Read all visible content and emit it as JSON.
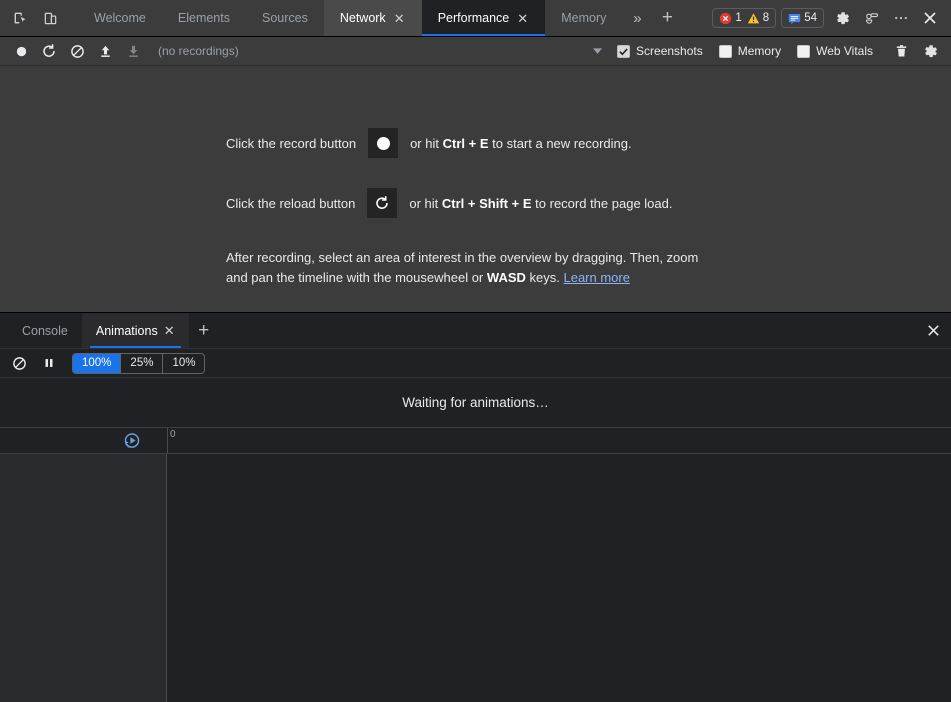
{
  "topbar": {
    "left_icons": [
      {
        "name": "inspect-element-icon",
        "label": "Inspect element"
      },
      {
        "name": "device-toolbar-icon",
        "label": "Toggle device toolbar"
      }
    ],
    "tabs": [
      {
        "label": "Welcome",
        "state": "inactive",
        "closable": false
      },
      {
        "label": "Elements",
        "state": "inactive",
        "closable": false
      },
      {
        "label": "Sources",
        "state": "inactive",
        "closable": false
      },
      {
        "label": "Network",
        "state": "selected-bg",
        "closable": true
      },
      {
        "label": "Performance",
        "state": "active",
        "closable": true
      },
      {
        "label": "Memory",
        "state": "inactive",
        "closable": false
      }
    ],
    "more_tabs_label": "»",
    "add_tab_label": "+",
    "errors_count": "1",
    "warnings_count": "8",
    "messages_count": "54",
    "settings_label": "Settings",
    "customize_label": "Customize and control DevTools",
    "close_label": "Close DevTools",
    "accent_blue": "#1a73e8",
    "error_red": "#e53935",
    "warning_yellow": "#fbc02d",
    "message_blue": "#4285f4"
  },
  "perf_toolbar": {
    "record_label": "Record",
    "reload_record_label": "Start profiling and reload page",
    "clear_label": "Clear",
    "upload_label": "Load profile",
    "download_label": "Save profile",
    "recordings_text": "(no recordings)",
    "history_caret": "▾",
    "checkboxes": [
      {
        "label": "Screenshots",
        "checked": true
      },
      {
        "label": "Memory",
        "checked": false
      },
      {
        "label": "Web Vitals",
        "checked": false
      }
    ],
    "trash_label": "Collect garbage",
    "capture_settings_label": "Capture settings"
  },
  "perf_landing": {
    "line1_pre": "Click the record button",
    "line1_post_a": "or hit",
    "line1_key1": "Ctrl",
    "line1_plus": "+",
    "line1_key2": "E",
    "line1_post_b": "to start a new recording.",
    "line2_pre": "Click the reload button",
    "line2_post_a": "or hit",
    "line2_key1": "Ctrl",
    "line2_key2": "Shift",
    "line2_key3": "E",
    "line2_post_b": "to record the page load.",
    "para_part1": "After recording, select an area of interest in the overview by dragging. Then, zoom and pan the timeline with the mousewheel or",
    "para_kbd": "WASD",
    "para_part2": "keys.",
    "learn_more": "Learn more"
  },
  "drawer": {
    "tabs": [
      {
        "label": "Console",
        "active": false,
        "closable": false
      },
      {
        "label": "Animations",
        "active": true,
        "closable": true
      }
    ],
    "add_tab_label": "+",
    "close_label": "Close drawer"
  },
  "animations": {
    "clear_label": "Clear all",
    "pause_label": "Pause all",
    "speed_options": [
      {
        "label": "100%",
        "active": true
      },
      {
        "label": "25%",
        "active": false
      },
      {
        "label": "10%",
        "active": false
      }
    ],
    "waiting_text": "Waiting for animations…",
    "replay_label": "Replay timeline",
    "timeline_tick_label": "0"
  }
}
